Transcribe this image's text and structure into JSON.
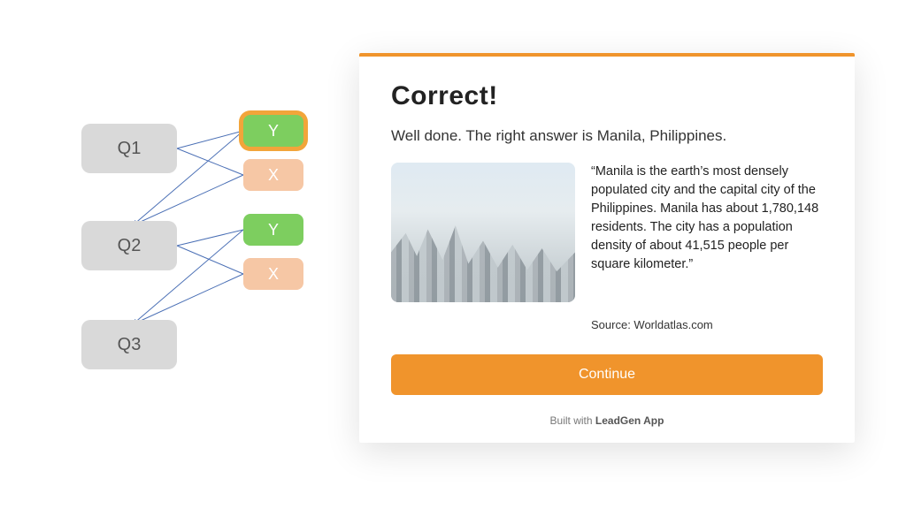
{
  "diagram": {
    "q1": "Q1",
    "q2": "Q2",
    "q3": "Q3",
    "group1_y": "Y",
    "group1_x": "X",
    "group2_y": "Y",
    "group2_x": "X"
  },
  "card": {
    "title": "Correct!",
    "subtitle": "Well done. The right answer is Manila, Philippines.",
    "quote": "“Manila is the earth’s most densely populated city and the capital city of the Philippines. Manila has about 1,780,148 residents. The city has a population density of about 41,515 people per square kilometer.”",
    "source": "Source: Worldatlas.com",
    "continue_label": "Continue",
    "footer_prefix": "Built with ",
    "footer_brand": "LeadGen App"
  }
}
